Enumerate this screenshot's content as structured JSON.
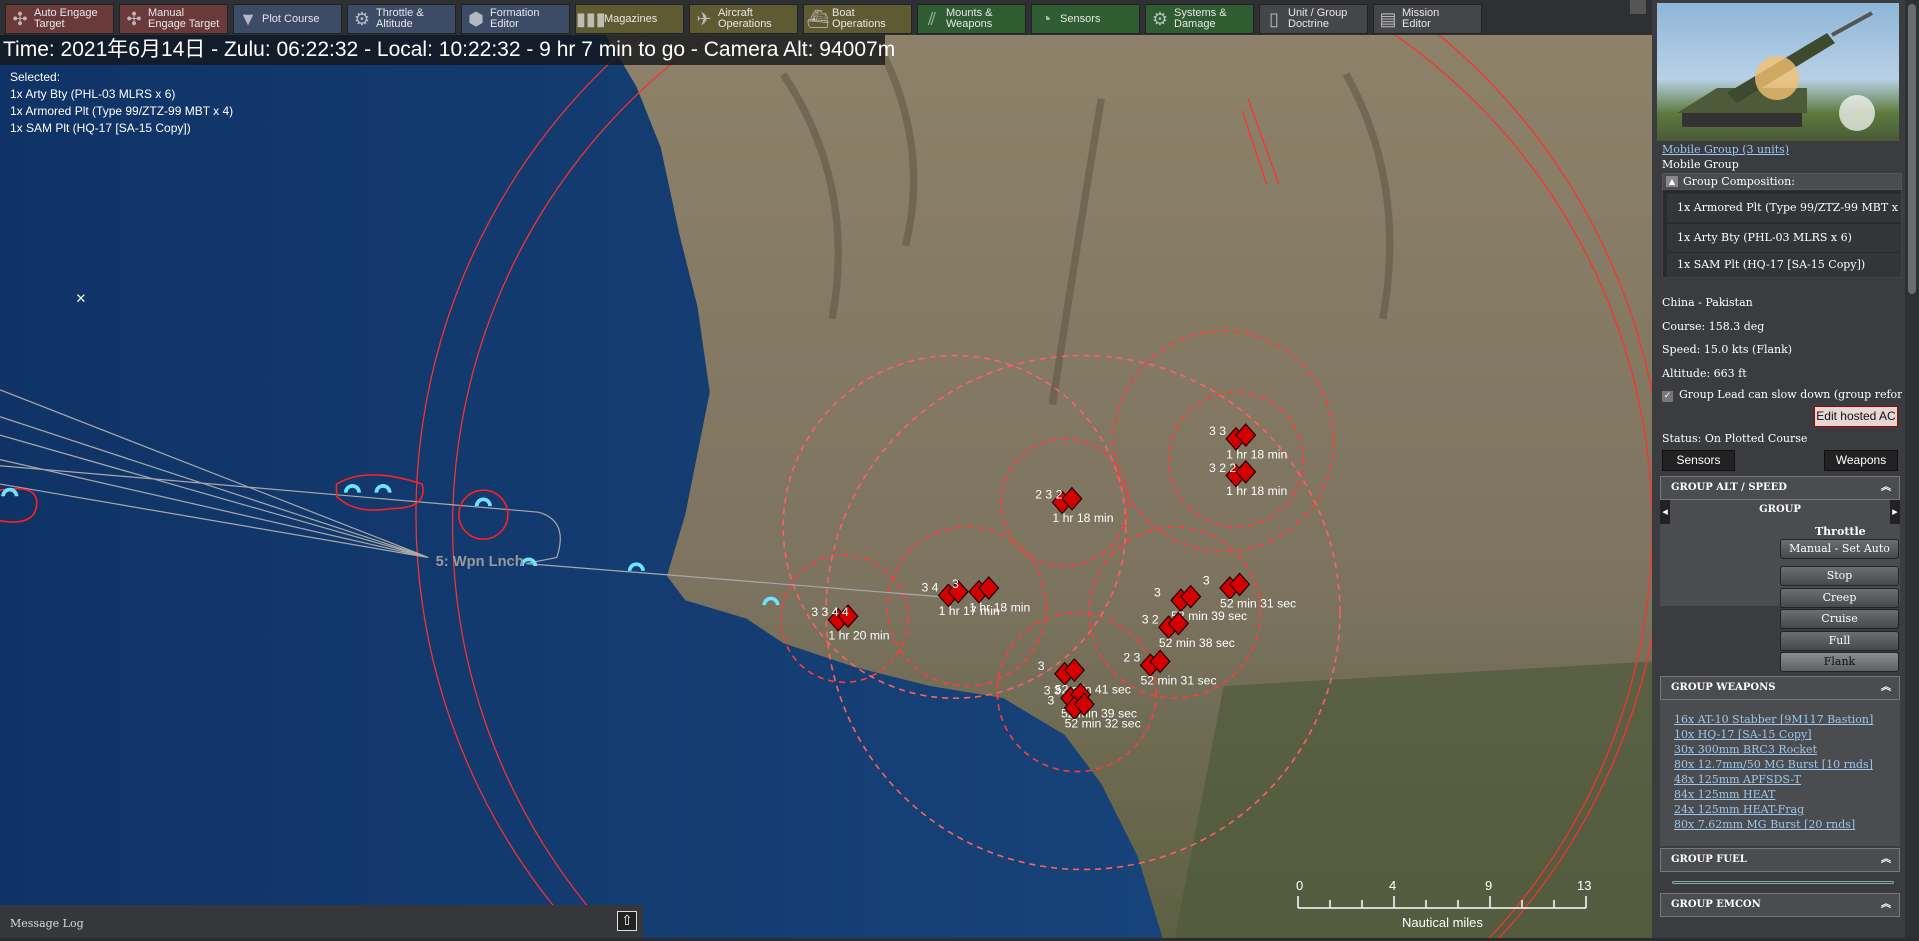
{
  "toolbar": [
    {
      "l1": "Auto Engage",
      "l2": "Target",
      "c": "red",
      "icon": "crosshair-icon",
      "g": "✣"
    },
    {
      "l1": "Manual",
      "l2": "Engage Target",
      "c": "red",
      "icon": "crosshair-icon",
      "g": "✣"
    },
    {
      "l1": "Plot Course",
      "l2": "",
      "c": "blue",
      "icon": "course-icon",
      "g": "▼"
    },
    {
      "l1": "Throttle &",
      "l2": "Altitude",
      "c": "blue",
      "icon": "throttle-icon",
      "g": "⚙"
    },
    {
      "l1": "Formation",
      "l2": "Editor",
      "c": "blue",
      "icon": "formation-icon",
      "g": "⬢"
    },
    {
      "l1": "Magazines",
      "l2": "",
      "c": "olive",
      "icon": "magazine-icon",
      "g": "▮▮▮"
    },
    {
      "l1": "Aircraft",
      "l2": "Operations",
      "c": "olive",
      "icon": "aircraft-icon",
      "g": "✈"
    },
    {
      "l1": "Boat",
      "l2": "Operations",
      "c": "olive",
      "icon": "boat-icon",
      "g": "⛴"
    },
    {
      "l1": "Mounts &",
      "l2": "Weapons",
      "c": "green",
      "icon": "weapons-icon",
      "g": "⫽"
    },
    {
      "l1": "Sensors",
      "l2": "",
      "c": "green",
      "icon": "sensor-icon",
      "g": "◔"
    },
    {
      "l1": "Systems &",
      "l2": "Damage",
      "c": "green",
      "icon": "gear-icon",
      "g": "⚙"
    },
    {
      "l1": "Unit / Group",
      "l2": "Doctrine",
      "c": "gray",
      "icon": "document-icon",
      "g": "▯"
    },
    {
      "l1": "Mission",
      "l2": "Editor",
      "c": "gray",
      "icon": "mission-icon",
      "g": "▤"
    }
  ],
  "status_bar": "Time: 2021年6月14日 - Zulu: 06:22:32 - Local: 10:22:32 - 9 hr 7 min to go -  Camera Alt: 94007m",
  "selected": {
    "title": "Selected:",
    "items": [
      "1x Arty Bty (PHL-03 MLRS x 6)",
      "1x Armored Plt (Type 99/ZTZ-99 MBT x 4)",
      "1x SAM Plt (HQ-17 [SA-15 Copy])"
    ]
  },
  "map": {
    "waypoint_label": "5: Wpn Lnch",
    "unit_labels": [
      {
        "n": "3 3",
        "t": "1 hr 18 min"
      },
      {
        "n": "3 2 2",
        "t": "1 hr 18 min"
      },
      {
        "n": "2 3 2",
        "t": "1 hr 18 min"
      },
      {
        "n": "3 4",
        "t": "1 hr 17 min"
      },
      {
        "n": "3",
        "t": "1 hr 18 min"
      },
      {
        "n": "3 3 4 4",
        "t": "1 hr 20 min"
      },
      {
        "n": "3",
        "t": "52 min 31 sec"
      },
      {
        "n": "3",
        "t": "52 min 39 sec"
      },
      {
        "n": "3 2",
        "t": "52 min 38 sec"
      },
      {
        "n": "2 3",
        "t": "52 min 31 sec"
      },
      {
        "n": "3",
        "t": "52 min 41 sec"
      },
      {
        "n": "3 3",
        "t": "52 min 39 sec"
      },
      {
        "n": "3",
        "t": "52 min 32 sec"
      }
    ]
  },
  "scale": {
    "ticks": [
      "0",
      "4",
      "9",
      "13"
    ],
    "unit": "Nautical miles"
  },
  "message_log": "Message Log",
  "panel": {
    "group_link": "Mobile Group (3 units)",
    "group_type": "Mobile Group",
    "composition_title": "Group Composition:",
    "composition": [
      "1x Armored Plt (Type 99/ZTZ-99 MBT x",
      "1x Arty Bty (PHL-03 MLRS x 6)",
      "1x SAM Plt (HQ-17 [SA-15 Copy])"
    ],
    "side": "China - Pakistan",
    "course": "Course: 158.3 deg",
    "speed": "Speed: 15.0 kts (Flank)",
    "altitude": "Altitude: 663 ft",
    "checkbox": "Group Lead can slow down (group refor",
    "edit_hosted": "Edit hosted AC",
    "status": "Status: On Plotted Course",
    "sensors_btn": "Sensors",
    "weapons_btn": "Weapons",
    "alt_speed": {
      "title": "GROUP ALT / SPEED",
      "selector": "GROUP",
      "throttle_label": "Throttle",
      "manual": "Manual - Set Auto",
      "options": [
        "Stop",
        "Creep",
        "Cruise",
        "Full",
        "Flank"
      ],
      "selected": "Flank"
    },
    "weapons": {
      "title": "GROUP WEAPONS",
      "items": [
        "16x AT-10 Stabber [9M117 Bastion]",
        "10x HQ-17 [SA-15 Copy]",
        "30x 300mm BRC3 Rocket",
        "80x 12.7mm/50 MG Burst [10 rnds]",
        "48x 125mm APFSDS-T",
        "84x 125mm HEAT",
        "24x 125mm HEAT-Frag",
        "80x 7.62mm MG Burst [20 rnds]"
      ]
    },
    "fuel": {
      "title": "GROUP FUEL"
    },
    "emcon": {
      "title": "GROUP EMCON"
    }
  }
}
